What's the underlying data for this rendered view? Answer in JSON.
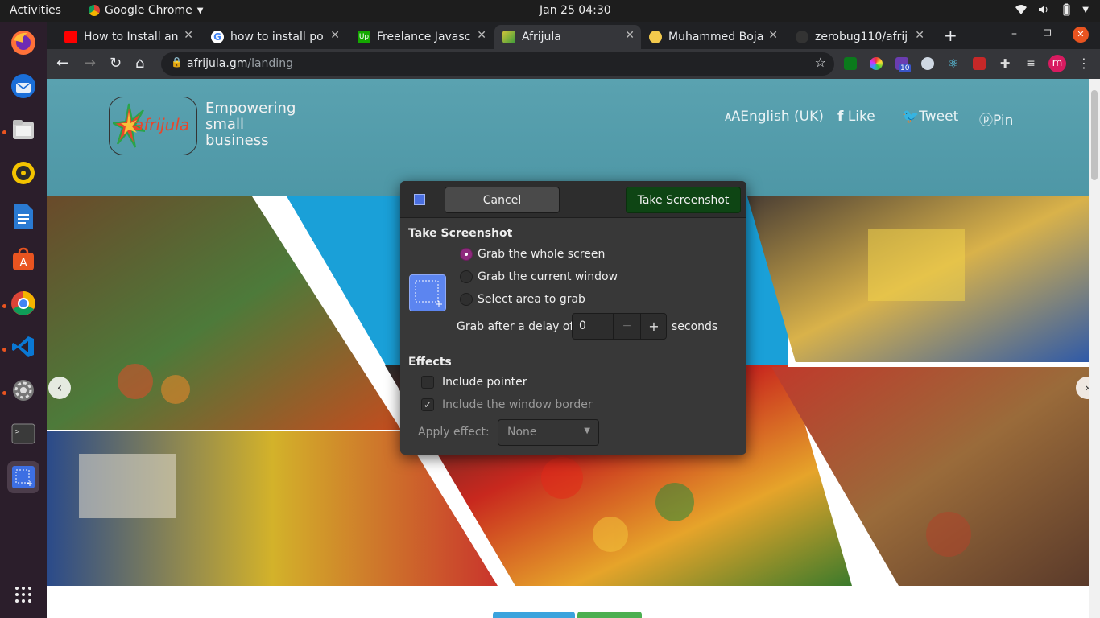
{
  "topbar": {
    "activities": "Activities",
    "app_name": "Google Chrome",
    "clock": "Jan 25  04:30",
    "tray_icons": [
      "wifi-icon",
      "volume-icon",
      "battery-icon",
      "power-menu-icon"
    ]
  },
  "dock": {
    "items": [
      "firefox-icon",
      "thunderbird-icon",
      "files-icon",
      "rhythmbox-icon",
      "writer-icon",
      "software-center-icon",
      "chrome-icon",
      "vscode-icon",
      "settings-icon",
      "terminal-icon",
      "screenshot-icon",
      "app-grid-icon"
    ]
  },
  "tabs": [
    {
      "title": "How to Install an",
      "favicon_color": "#ff0000"
    },
    {
      "title": "how to install po",
      "favicon_color": "#ffffff"
    },
    {
      "title": "Freelance Javasc",
      "favicon_color": "#14a800"
    },
    {
      "title": "Afrijula",
      "favicon_color": "#d4c43a"
    },
    {
      "title": "Muhammed Boja",
      "favicon_color": "#f2c94c"
    },
    {
      "title": "zerobug110/afrij",
      "favicon_color": "#333333"
    }
  ],
  "active_tab": 3,
  "omnibox": {
    "host": "afrijula.gm",
    "path": "/landing"
  },
  "extensions": {
    "badge_count": "10",
    "profile_initial": "m"
  },
  "site": {
    "logo_text": "afrijula",
    "tagline": [
      "Empowering",
      "small",
      "business"
    ],
    "nav": {
      "language": "English (UK)",
      "like": "Like",
      "tweet": "Tweet",
      "pin": "Pin"
    }
  },
  "dialog": {
    "cancel_label": "Cancel",
    "take_label": "Take Screenshot",
    "section_take": "Take Screenshot",
    "options": [
      {
        "label": "Grab the whole screen",
        "selected": true
      },
      {
        "label": "Grab the current window",
        "selected": false
      },
      {
        "label": "Select area to grab",
        "selected": false
      }
    ],
    "delay_prefix": "Grab after a delay of",
    "delay_value": "0",
    "delay_suffix": "seconds",
    "section_effects": "Effects",
    "include_pointer": "Include pointer",
    "include_border": "Include the window border",
    "apply_effect_label": "Apply effect:",
    "apply_effect_value": "None"
  }
}
